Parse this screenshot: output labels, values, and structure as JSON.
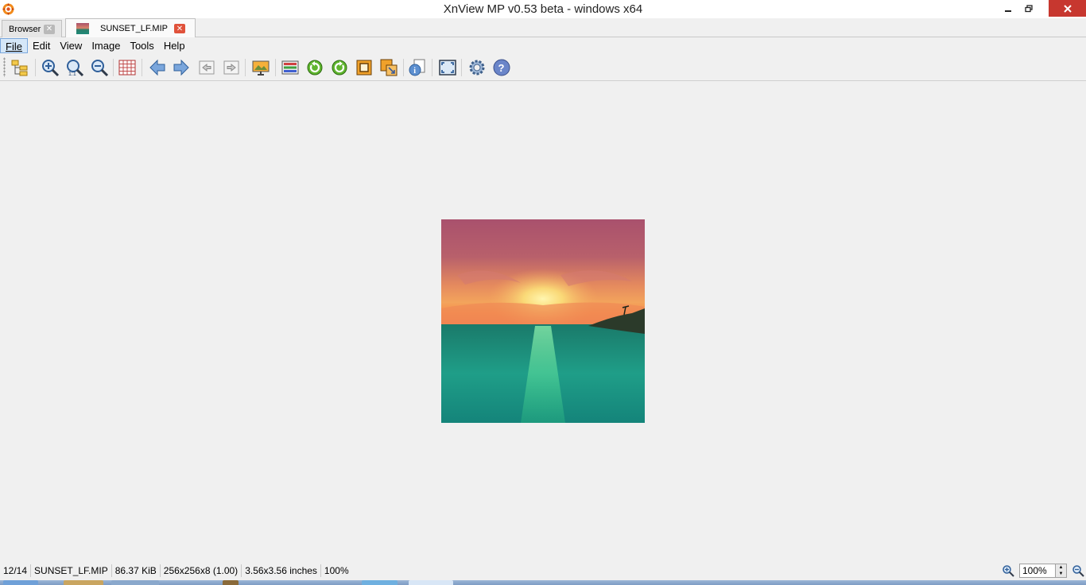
{
  "window": {
    "title": "XnView MP v0.53 beta - windows x64"
  },
  "tabs": [
    {
      "label": "Browser"
    },
    {
      "label": "SUNSET_LF.MIP"
    }
  ],
  "menu": [
    "File",
    "Edit",
    "View",
    "Image",
    "Tools",
    "Help"
  ],
  "toolbar_icons": [
    "browse-tree-icon",
    "zoom-in-icon",
    "zoom-actual-icon",
    "zoom-out-icon",
    "grid-icon",
    "previous-icon",
    "next-icon",
    "first-page-icon",
    "last-page-icon",
    "slideshow-icon",
    "adjust-icon",
    "rotate-left-icon",
    "rotate-right-icon",
    "crop-icon",
    "resize-icon",
    "info-icon",
    "fullscreen-icon",
    "settings-icon",
    "help-icon"
  ],
  "image": {
    "name": "SUNSET_LF.MIP"
  },
  "status": {
    "index": "12/14",
    "filename": "SUNSET_LF.MIP",
    "filesize": "86.37 KiB",
    "dimensions": "256x256x8 (1.00)",
    "print_size": "3.56x3.56 inches",
    "zoom": "100%"
  },
  "zoom_control": {
    "value": "100%"
  },
  "colors": {
    "close_button": "#c7372f",
    "menu_active": "#d5e7f8",
    "tab_close_active": "#e0523b"
  }
}
